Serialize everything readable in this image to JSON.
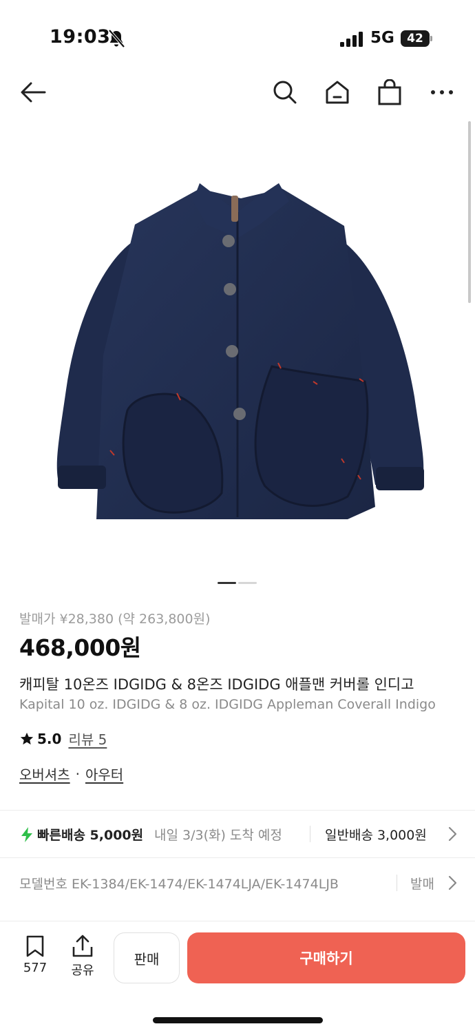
{
  "status_bar": {
    "time": "19:03",
    "network": "5G",
    "battery": "42"
  },
  "nav": {
    "icons": [
      "back-arrow-icon",
      "search-icon",
      "home-icon",
      "shopping-bag-icon",
      "more-icon"
    ]
  },
  "product": {
    "image_alt": "Navy indigo coverall jacket",
    "page_indicator": {
      "current": 1,
      "total": 2
    },
    "release_price": "발매가 ¥28,380 (약 263,800원)",
    "price": "468,000원",
    "name_ko": "캐피탈 10온즈 IDGIDG & 8온즈 IDGIDG 애플맨 커버롤 인디고",
    "name_en": "Kapital 10 oz. IDGIDG & 8 oz. IDGIDG Appleman Coverall Indigo",
    "rating": "5.0",
    "review_link": "리뷰 5",
    "category_main": "오버셔츠",
    "category_sep": "·",
    "category_sub": "아우터"
  },
  "delivery": {
    "fast_label": "빠른배송 5,000원",
    "fast_eta": "내일 3/3(화) 도착 예정",
    "normal_label": "일반배송 3,000원",
    "accent": "#2fbf4a"
  },
  "model": {
    "text": "모델번호 EK-1384/EK-1474/EK-1474LJA/EK-1474LJB",
    "more": "발매"
  },
  "bottom_bar": {
    "bookmark_count": "577",
    "share_label": "공유",
    "sell_label": "판매",
    "buy_label": "구매하기",
    "buy_color": "#ef6253"
  }
}
